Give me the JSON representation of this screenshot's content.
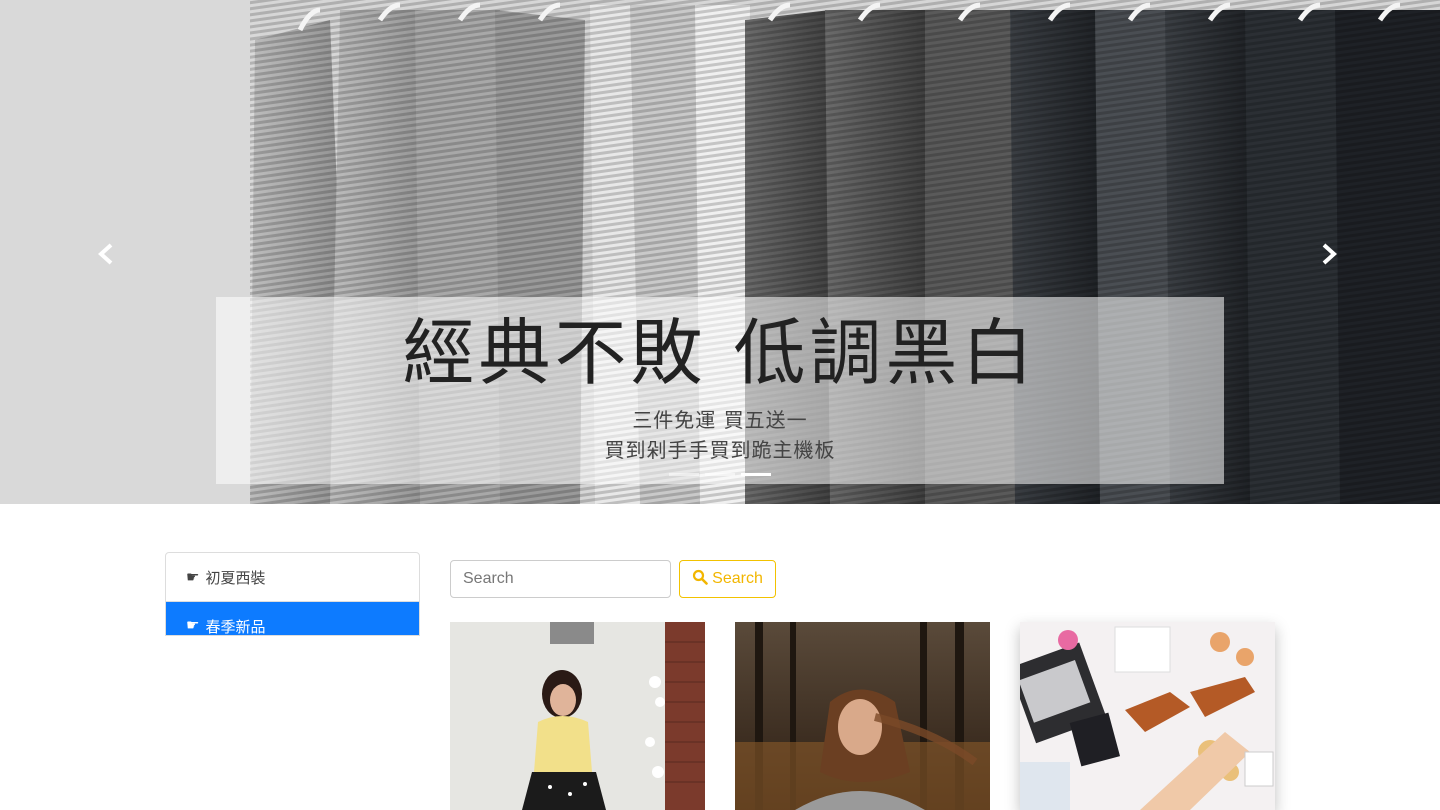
{
  "hero": {
    "title": "經典不敗 低調黑白",
    "subtitle_line1": "三件免運 買五送一",
    "subtitle_line2": "買到剁手手買到跪主機板",
    "prev_icon": "chevron-left-icon",
    "next_icon": "chevron-right-icon",
    "slide_count": 3,
    "active_slide": 3
  },
  "sidebar": {
    "items": [
      {
        "label": "初夏西裝",
        "icon": "pointing-hand-icon",
        "active": false
      },
      {
        "label": "春季新品",
        "icon": "pointing-hand-icon",
        "active": true
      }
    ]
  },
  "search": {
    "placeholder": "Search",
    "value": "",
    "button_label": "Search",
    "button_icon": "search-icon"
  },
  "products": [
    {
      "image": "woman-yellow-top-photo"
    },
    {
      "image": "woman-forest-hair-photo"
    },
    {
      "image": "flatlay-laptop-sandals-photo"
    }
  ],
  "colors": {
    "active_item": "#0d7bff",
    "search_button": "#f2b600"
  }
}
